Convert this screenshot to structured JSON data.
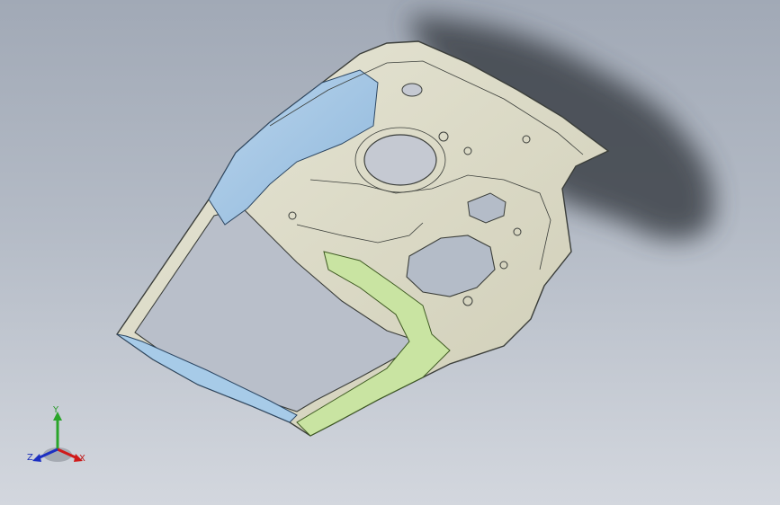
{
  "app": {
    "window": "cad-graphics-area",
    "view": "trimetric",
    "model": "door-inner-panel-assembly"
  },
  "colors": {
    "background_top": "#a1a9b6",
    "background_bottom": "#d3d7de",
    "panel_base": "#d9d8c4",
    "blue_part": "#9ec3e3",
    "green_part": "#c9e4a2",
    "edge": "#3b3e3a",
    "shadow": "#3e4248"
  },
  "triad": {
    "y_label": "Y",
    "x_label": "X",
    "z_label": "Z",
    "y_color": "#2aa52a",
    "x_color": "#d01a1a",
    "z_color": "#1c2fc2"
  }
}
